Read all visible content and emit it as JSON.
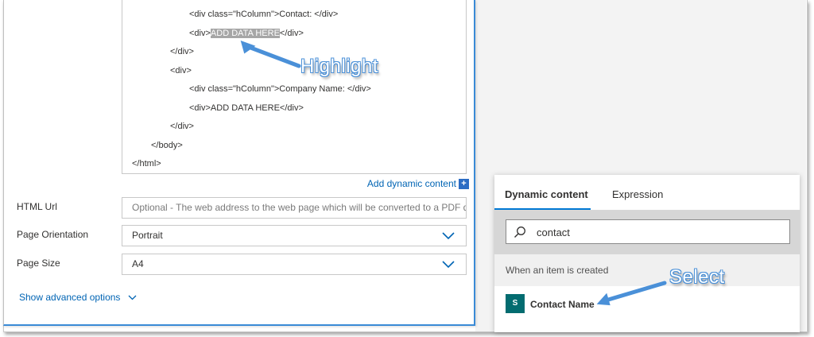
{
  "code": {
    "lines": [
      "<div class=\"hColumn\">Contact: </div>",
      "<div>",
      "ADD DATA HERE",
      "</div>",
      "</div>",
      "<div>",
      "<div class=\"hColumn\">Company Name: </div>",
      "<div>ADD DATA HERE</div>",
      "</div>",
      "</body>",
      "</html>"
    ]
  },
  "add_dynamic_content": "Add dynamic content",
  "plus_symbol": "+",
  "fields": {
    "html_url": {
      "label": "HTML Url",
      "placeholder": "Optional - The web address to the web page which will be converted to a PDF d"
    },
    "orientation": {
      "label": "Page Orientation",
      "value": "Portrait"
    },
    "page_size": {
      "label": "Page Size",
      "value": "A4"
    }
  },
  "advanced_options": "Show advanced options",
  "panel": {
    "tabs": [
      {
        "label": "Dynamic content",
        "active": true
      },
      {
        "label": "Expression",
        "active": false
      }
    ],
    "search_value": "contact",
    "group_header": "When an item is created",
    "item": {
      "label": "Contact Name",
      "icon": "sharepoint-icon",
      "icon_text": "S"
    }
  },
  "annotations": {
    "highlight": "Highlight",
    "select": "Select"
  },
  "colors": {
    "link": "#0064b4",
    "accent": "#0078d4",
    "callout_outline": "#4a90d8",
    "sharepoint": "#036c70"
  }
}
